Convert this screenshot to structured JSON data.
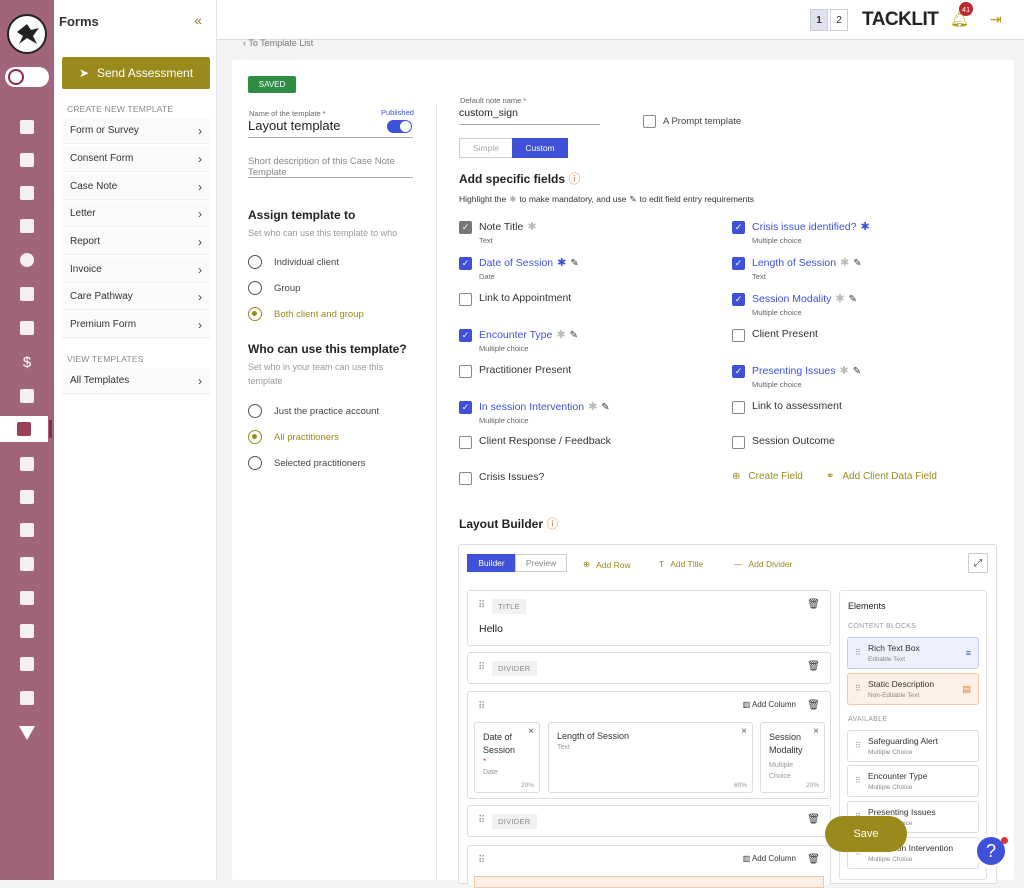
{
  "sidebar": {
    "title": "Forms",
    "send_label": "Send Assessment",
    "create_header": "CREATE NEW TEMPLATE",
    "create_items": [
      "Form or Survey",
      "Consent Form",
      "Case Note",
      "Letter",
      "Report",
      "Invoice",
      "Care Pathway",
      "Premium Form"
    ],
    "view_header": "VIEW TEMPLATES",
    "view_items": [
      "All Templates"
    ]
  },
  "topbar": {
    "pages": [
      "1",
      "2"
    ],
    "brand": "TACKLIT",
    "notifications": "41",
    "back_link": "To Template List"
  },
  "template": {
    "status": "SAVED",
    "name_label": "Name of the template *",
    "name_value": "Layout template",
    "published_label": "Published",
    "published": true,
    "description_placeholder": "Short description of this Case Note Template",
    "default_note_label": "Default note name *",
    "default_note_value": "custom_sign",
    "prompt_label": "A Prompt template",
    "mode_options": [
      "Simple",
      "Custom"
    ],
    "mode_selected": "Custom"
  },
  "assign": {
    "title": "Assign template to",
    "desc": "Set who can use this template to who",
    "options": [
      "Individual client",
      "Group",
      "Both client and group"
    ],
    "selected": "Both client and group"
  },
  "who": {
    "title": "Who can use this template?",
    "desc": "Set who in your team can use this template",
    "options": [
      "Just the practice account",
      "All practitioners",
      "Selected practitioners"
    ],
    "selected": "All practitioners"
  },
  "fields_section": {
    "title": "Add specific fields",
    "hint_pre": "Highlight the",
    "hint_mid": "to make mandatory, and use",
    "hint_post": "to edit field entry requirements",
    "left": [
      {
        "label": "Note Title",
        "sub": "Text",
        "checked": true,
        "locked": true
      },
      {
        "label": "Date of Session",
        "sub": "Date",
        "checked": true
      },
      {
        "label": "Link to Appointment",
        "sub": "",
        "checked": false
      },
      {
        "label": "Encounter Type",
        "sub": "Multiple choice",
        "checked": true
      },
      {
        "label": "Practitioner Present",
        "sub": "",
        "checked": false
      },
      {
        "label": "In session Intervention",
        "sub": "Multiple choice",
        "checked": true
      },
      {
        "label": "Client Response / Feedback",
        "sub": "",
        "checked": false
      },
      {
        "label": "Crisis Issues?",
        "sub": "",
        "checked": false
      }
    ],
    "right": [
      {
        "label": "Crisis issue identified?",
        "sub": "Multiple choice",
        "checked": true
      },
      {
        "label": "Length of Session",
        "sub": "Text",
        "checked": true
      },
      {
        "label": "Session Modality",
        "sub": "Multiple choice",
        "checked": true
      },
      {
        "label": "Client Present",
        "sub": "",
        "checked": false
      },
      {
        "label": "Presenting Issues",
        "sub": "Multiple choice",
        "checked": true
      },
      {
        "label": "Link to assessment",
        "sub": "",
        "checked": false
      },
      {
        "label": "Session Outcome",
        "sub": "",
        "checked": false
      }
    ],
    "create_field": "Create Field",
    "add_client_field": "Add Client Data Field"
  },
  "layout_builder": {
    "title": "Layout Builder",
    "tabs": [
      "Builder",
      "Preview"
    ],
    "actions": [
      "Add Row",
      "Add Title",
      "Add Divider"
    ],
    "title_chip": "TITLE",
    "title_value": "Hello",
    "divider_chip": "DIVIDER",
    "add_column": "Add Column",
    "columns": [
      {
        "label": "Date of Session",
        "type": "Date",
        "pct": "20%",
        "required": true
      },
      {
        "label": "Length of Session",
        "type": "Text",
        "pct": "60%",
        "required": false
      },
      {
        "label": "Session Modality",
        "type": "Multiple Choice",
        "pct": "20%",
        "required": false
      }
    ],
    "elements": {
      "title": "Elements",
      "content_header": "CONTENT BLOCKS",
      "content": [
        {
          "label": "Rich Text Box",
          "sub": "Editable Text"
        },
        {
          "label": "Static Description",
          "sub": "Non-Editable Text"
        }
      ],
      "available_header": "AVAILABLE",
      "available": [
        {
          "label": "Safeguarding Alert",
          "sub": "Multiple Choice"
        },
        {
          "label": "Encounter Type",
          "sub": "Multiple Choice"
        },
        {
          "label": "Presenting Issues",
          "sub": "Multiple Choice"
        },
        {
          "label": "In session Intervention",
          "sub": "Multiple Choice"
        }
      ]
    }
  },
  "save_label": "Save",
  "colors": {
    "accent": "#9a8a1c",
    "brand": "#a0657a",
    "blue": "#3f51d8"
  }
}
